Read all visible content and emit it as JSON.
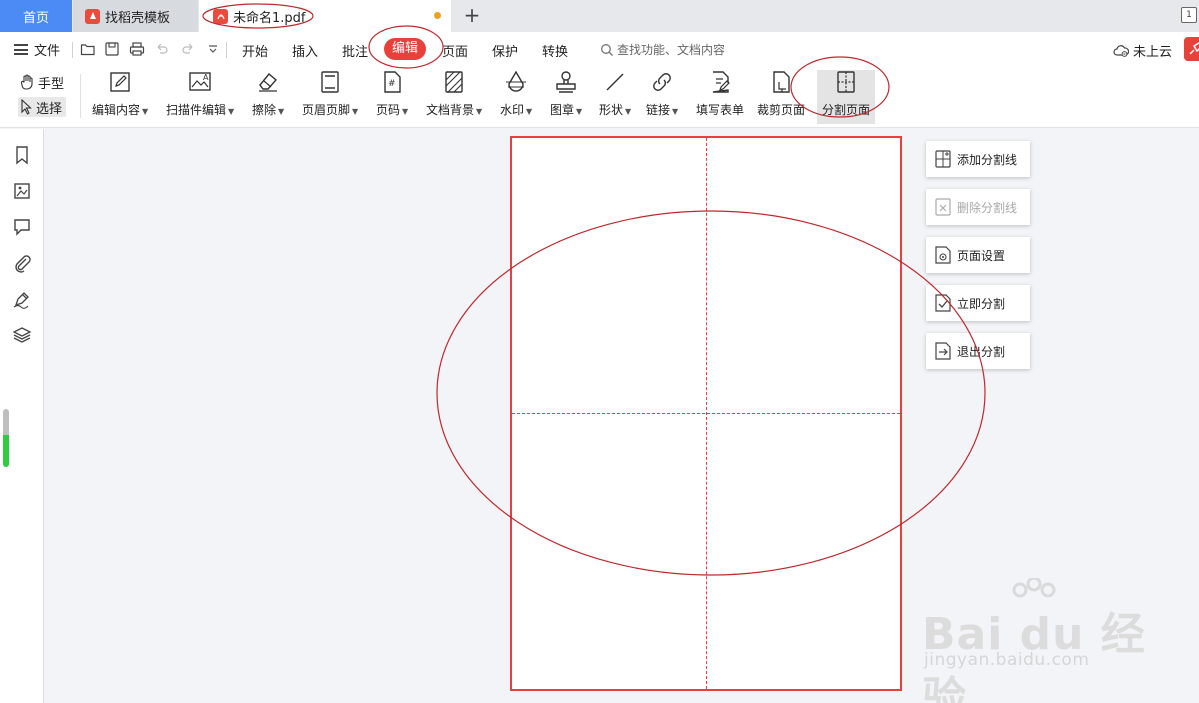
{
  "tabs": {
    "home": "首页",
    "template": "找稻壳模板",
    "document": "未命名1.pdf",
    "add_glyph": "+",
    "right_glyph": "1"
  },
  "menu": {
    "file": "文件",
    "items": [
      "开始",
      "插入",
      "批注",
      "编辑",
      "页面",
      "保护",
      "转换"
    ],
    "active": "编辑",
    "search_placeholder": "查找功能、文档内容",
    "cloud": "未上云"
  },
  "modes": {
    "hand": "手型",
    "select": "选择"
  },
  "ribbon": {
    "tools": [
      {
        "label": "编辑内容",
        "icon": "edit-content-icon",
        "dropdown": true
      },
      {
        "label": "扫描件编辑",
        "icon": "scan-edit-icon",
        "dropdown": true
      },
      {
        "label": "擦除",
        "icon": "eraser-icon",
        "dropdown": true
      },
      {
        "label": "页眉页脚",
        "icon": "header-footer-icon",
        "dropdown": true
      },
      {
        "label": "页码",
        "icon": "page-number-icon",
        "dropdown": true
      },
      {
        "label": "文档背景",
        "icon": "background-icon",
        "dropdown": true
      },
      {
        "label": "水印",
        "icon": "watermark-icon",
        "dropdown": true
      },
      {
        "label": "图章",
        "icon": "stamp-icon",
        "dropdown": true
      },
      {
        "label": "形状",
        "icon": "shape-icon",
        "dropdown": true
      },
      {
        "label": "链接",
        "icon": "link-icon",
        "dropdown": true
      },
      {
        "label": "填写表单",
        "icon": "fill-form-icon",
        "dropdown": false
      },
      {
        "label": "裁剪页面",
        "icon": "crop-page-icon",
        "dropdown": false
      },
      {
        "label": "分割页面",
        "icon": "split-page-icon",
        "dropdown": false
      }
    ]
  },
  "split_panel": {
    "add_line": "添加分割线",
    "delete_line": "删除分割线",
    "page_settings": "页面设置",
    "split_now": "立即分割",
    "exit_split": "退出分割"
  },
  "watermark": {
    "main": "Bai du 经验",
    "sub": "jingyan.baidu.com"
  },
  "colors": {
    "accent": "#e8413b",
    "home_tab": "#4c8bf5",
    "modified_dot": "#f0a020"
  }
}
